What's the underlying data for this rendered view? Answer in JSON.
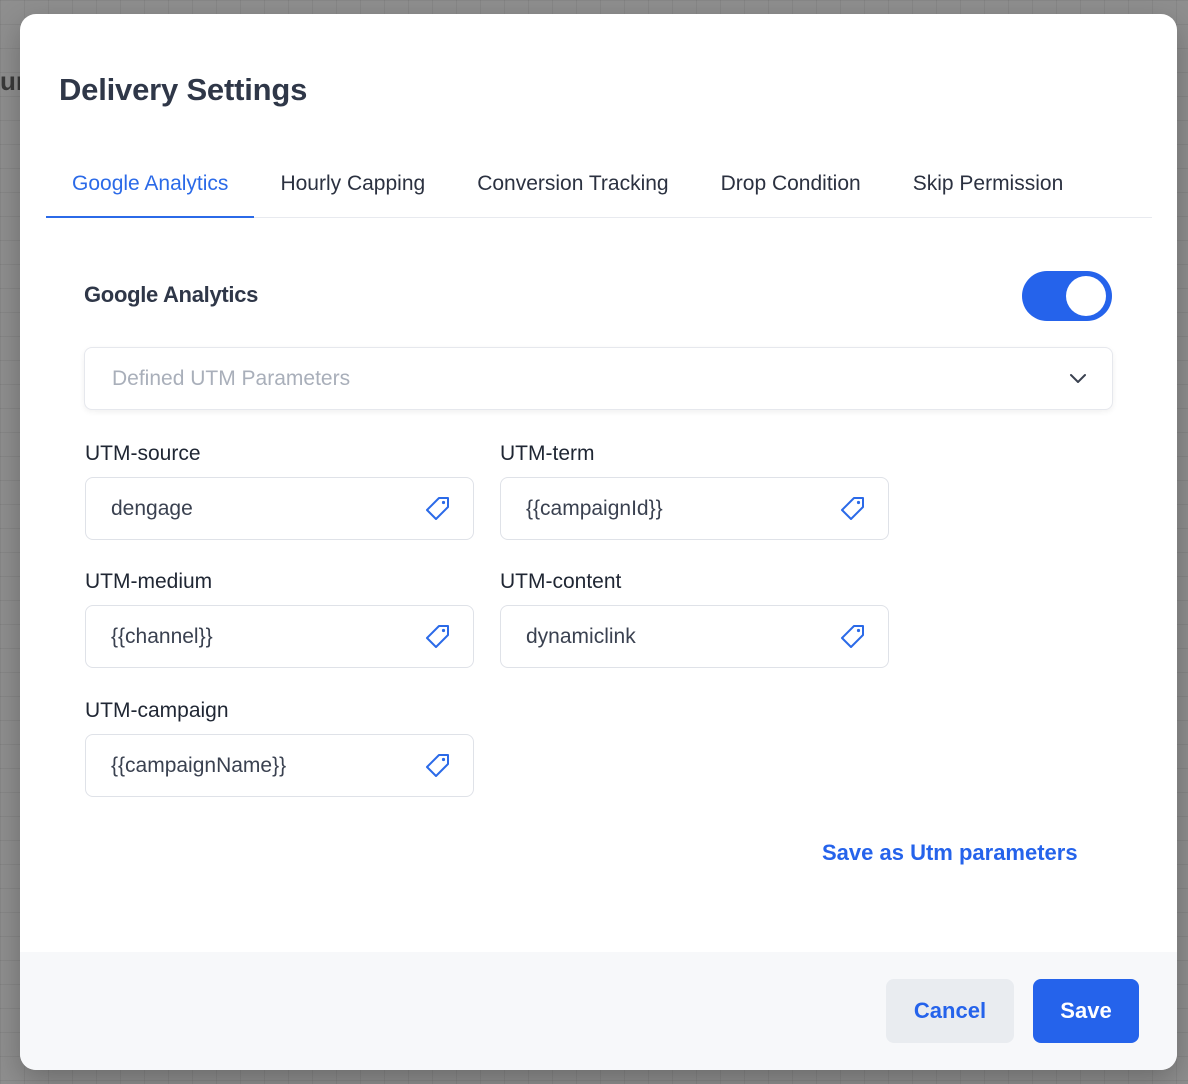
{
  "background": {
    "fragment": "ur"
  },
  "modal": {
    "title": "Delivery Settings",
    "tabs": [
      {
        "label": "Google Analytics",
        "active": true
      },
      {
        "label": "Hourly Capping",
        "active": false
      },
      {
        "label": "Conversion Tracking",
        "active": false
      },
      {
        "label": "Drop Condition",
        "active": false
      },
      {
        "label": "Skip Permission",
        "active": false
      }
    ],
    "section": {
      "title": "Google Analytics",
      "toggle_on": true,
      "select_placeholder": "Defined UTM Parameters",
      "fields": {
        "utm_source": {
          "label": "UTM-source",
          "value": "dengage"
        },
        "utm_term": {
          "label": "UTM-term",
          "value": "{{campaignId}}"
        },
        "utm_medium": {
          "label": "UTM-medium",
          "value": "{{channel}}"
        },
        "utm_content": {
          "label": "UTM-content",
          "value": "dynamiclink"
        },
        "utm_campaign": {
          "label": "UTM-campaign",
          "value": "{{campaignName}}"
        }
      },
      "save_utm_label": "Save as Utm parameters"
    },
    "footer": {
      "cancel_label": "Cancel",
      "save_label": "Save"
    }
  },
  "colors": {
    "accent": "#2563eb",
    "title": "#2f3748",
    "overlay": "#8f8f8f"
  },
  "icons": {
    "chevron": "chevron-down-icon",
    "tag": "tag-icon"
  }
}
